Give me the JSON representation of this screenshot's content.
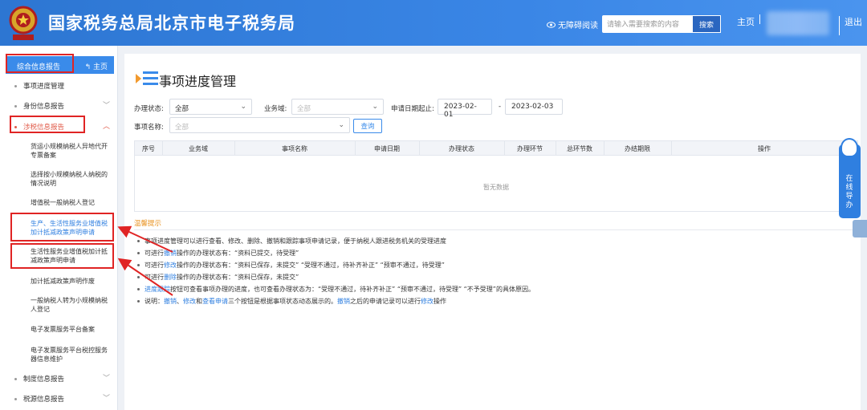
{
  "header": {
    "title": "国家税务总局北京市电子税务局",
    "accessibility": "无障碍阅读",
    "search_placeholder": "请输入需要搜索的内容",
    "search_button": "搜索",
    "home": "主页",
    "logout": "退出",
    "bg_color": "#3a86e6"
  },
  "sidebar": {
    "header_label": "综合信息报告",
    "home_label": "主页",
    "items": [
      {
        "label": "事项进度管理"
      },
      {
        "label": "身份信息报告"
      },
      {
        "label": "涉税信息报告"
      }
    ],
    "sub_items": [
      {
        "label": "货运小规模纳税人异地代开专票备案"
      },
      {
        "label": "选择按小规模纳税人纳税的情况说明"
      },
      {
        "label": "增值税一般纳税人登记"
      },
      {
        "label": "生产、生活性服务业增值税加计抵减政策声明申请"
      },
      {
        "label": "生活性服务业增值税加计抵减政策声明申请"
      },
      {
        "label": "加计抵减政策声明作废"
      },
      {
        "label": "一般纳税人转为小规模纳税人登记"
      },
      {
        "label": "电子发票服务平台备案"
      },
      {
        "label": "电子发票服务平台税控服务器信息维护"
      }
    ],
    "bottom_items": [
      {
        "label": "制度信息报告"
      },
      {
        "label": "税源信息报告"
      }
    ]
  },
  "main": {
    "title": "事项进度管理",
    "filters": {
      "status_label": "办理状态:",
      "status_value": "全部",
      "domain_label": "业务域:",
      "domain_value": "全部",
      "date_label": "申请日期起止:",
      "date_from": "2023-02-01",
      "date_dash": "-",
      "date_to": "2023-02-03",
      "name_label": "事项名称:",
      "name_value": "全部",
      "query_button": "查询"
    },
    "table": {
      "columns": [
        "序号",
        "业务域",
        "事项名称",
        "申请日期",
        "办理状态",
        "办理环节",
        "总环节数",
        "办结期限",
        "操作"
      ],
      "empty_text": "暂无数据"
    },
    "tips_title": "温馨提示",
    "tips": [
      {
        "pre": "事项进度管理可以进行查看、修改、删除、撤销和跟踪事项申请记录，便于纳税人跟进税务机关的受理进度",
        "hl": "",
        "post": ""
      },
      {
        "pre": "可进行",
        "hl": "撤销",
        "post": "操作的办理状态有：“资料已提交，待受理”"
      },
      {
        "pre": "可进行",
        "hl": "修改",
        "post": "操作的办理状态有：“资料已保存，未提交” “受理不通过，待补齐补正” “预审不通过，待受理”"
      },
      {
        "pre": "可进行",
        "hl": "删除",
        "post": "操作的办理状态有：“资料已保存，未提交”"
      },
      {
        "pre": "",
        "hl": "进度跟踪",
        "post": "按钮可查看事项办理的进度，也可查看办理状态为：“受理不通过，待补齐补正” “预审不通过，待受理” “不予受理”的具体原因。"
      }
    ],
    "last_tip": {
      "a": "说明：",
      "b": "撤销",
      "c": "、",
      "d": "修改",
      "e": "和",
      "f": "查看申请",
      "g": "三个按钮是根据事项状态动态展示的。",
      "h": "撤销",
      "i": "之后的申请记录可以进行",
      "j": "修改",
      "k": "操作"
    }
  },
  "online_service": {
    "label": "在线导办"
  }
}
